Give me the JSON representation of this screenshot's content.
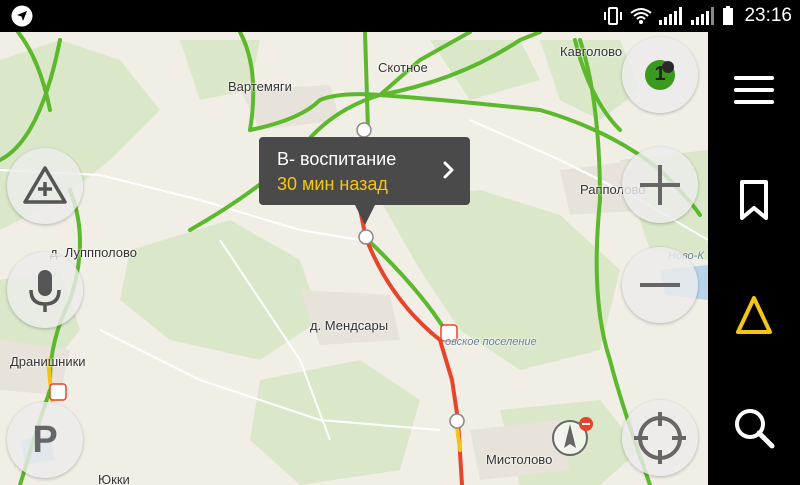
{
  "status_bar": {
    "time": "23:16",
    "icons": [
      "navigation-arrow-icon",
      "vibrate-icon",
      "wifi-icon",
      "signal-1-icon",
      "signal-2-icon",
      "battery-icon"
    ]
  },
  "map": {
    "places": [
      {
        "id": "kavgolovo",
        "name": "Кавголово"
      },
      {
        "id": "skotnoe",
        "name": "Скотное"
      },
      {
        "id": "vartemyagi",
        "name": "Вартемяги"
      },
      {
        "id": "rappolovo",
        "name": "Рапполово"
      },
      {
        "id": "luppolovo",
        "name": "д. Луппполово"
      },
      {
        "id": "mendsary",
        "name": "д. Мендсары"
      },
      {
        "id": "dranishniki",
        "name": "Дранишники"
      },
      {
        "id": "mistolovo",
        "name": "Мистолово"
      },
      {
        "id": "yukki",
        "name": "Юкки"
      },
      {
        "id": "novo",
        "name": "Ново-К"
      },
      {
        "id": "settlement",
        "name": "овское поселение"
      }
    ],
    "colors": {
      "traffic_green": "#5cb82c",
      "traffic_red": "#e8432b",
      "traffic_yellow": "#f2c318",
      "forest": "#d9e6c8",
      "land": "#f1eee6",
      "water": "#b8d4e8"
    }
  },
  "popup": {
    "title": "В- воспитание",
    "subtitle": "30 мин назад",
    "chevron_icon": "chevron-right-icon"
  },
  "controls": {
    "traffic_score": "1",
    "left_buttons": [
      "road-event-icon",
      "microphone-icon",
      "parking-icon"
    ],
    "right_buttons": [
      "traffic-badge",
      "zoom-in-icon",
      "zoom-out-icon",
      "locate-icon"
    ],
    "compass_icon": "compass-icon"
  },
  "side_panel": {
    "buttons": [
      "menu-icon",
      "bookmark-icon",
      "navigate-icon",
      "search-icon"
    ],
    "accent": "#f5c518"
  }
}
